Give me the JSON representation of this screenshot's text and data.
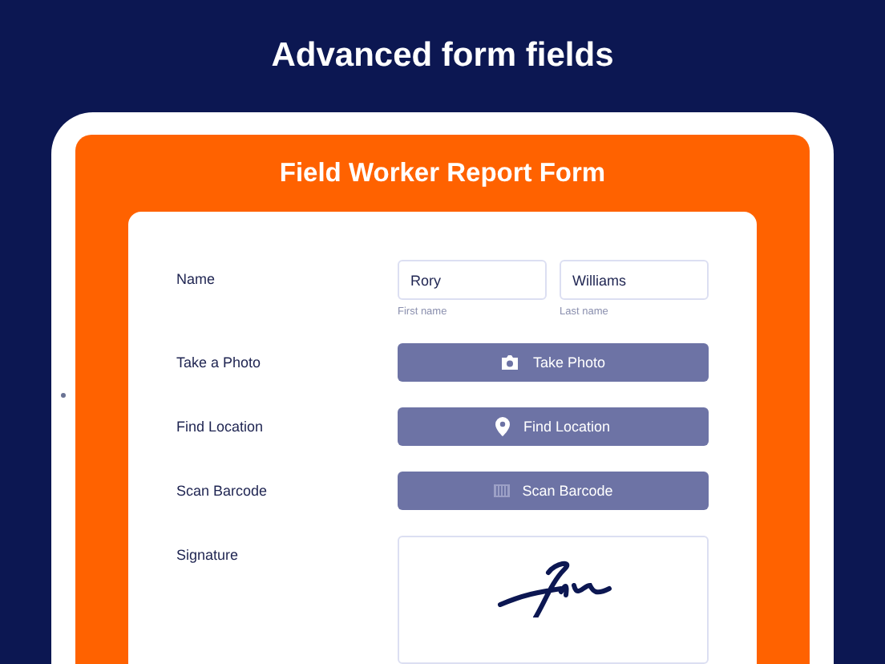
{
  "headline": "Advanced form fields",
  "form": {
    "title": "Field Worker Report Form",
    "rows": [
      {
        "kind": "name",
        "label": "Name",
        "first": {
          "value": "Rory",
          "hint": "First name"
        },
        "last": {
          "value": "Williams",
          "hint": "Last name"
        }
      },
      {
        "kind": "photo",
        "label": "Take a Photo",
        "button": "Take Photo"
      },
      {
        "kind": "location",
        "label": "Find Location",
        "button": "Find Location"
      },
      {
        "kind": "barcode",
        "label": "Scan Barcode",
        "button": "Scan Barcode"
      },
      {
        "kind": "signature",
        "label": "Signature"
      }
    ]
  }
}
